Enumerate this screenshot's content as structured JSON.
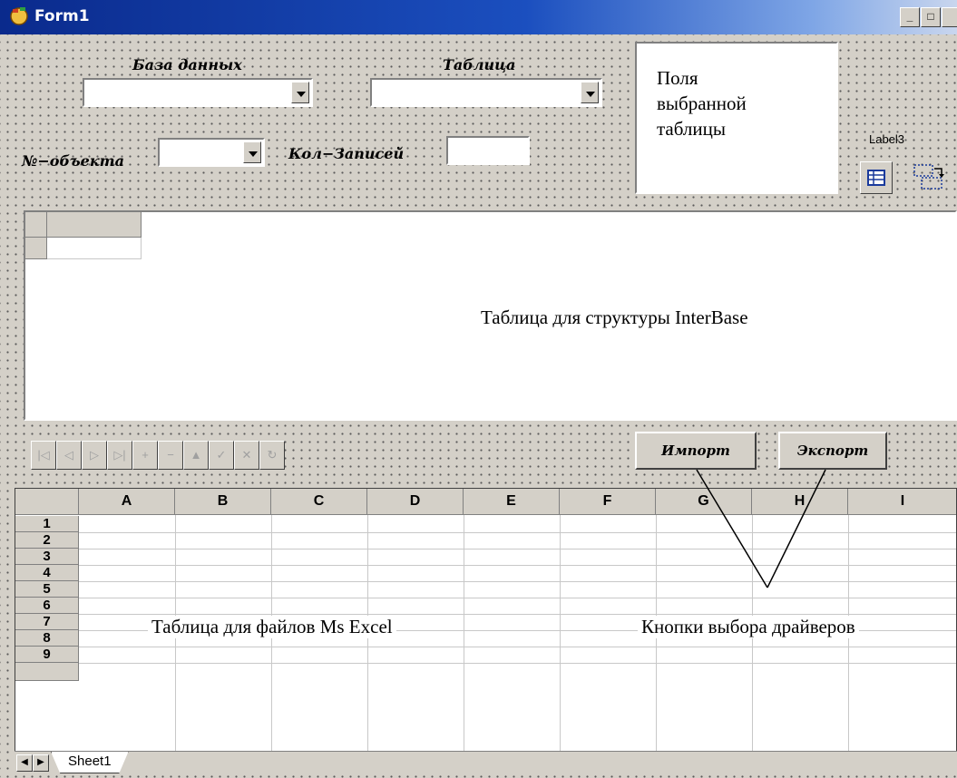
{
  "window": {
    "title": "Form1"
  },
  "labels": {
    "database": "База данных",
    "table": "Таблица",
    "object_no": "№−объекта",
    "record_count": "Кол−Записей",
    "label3": "Label3"
  },
  "fields_panel": {
    "text": "Поля\nвыбранной\nтаблицы"
  },
  "db_grid": {
    "caption": "Таблица для структуры InterBase"
  },
  "navigator": {
    "buttons": [
      "first",
      "prior",
      "next",
      "last",
      "insert",
      "delete",
      "edit",
      "post",
      "cancel",
      "refresh"
    ],
    "glyphs": [
      "|◁",
      "◁",
      "▷",
      "▷|",
      "+",
      "−",
      "▲",
      "✓",
      "✕",
      "↻"
    ]
  },
  "buttons": {
    "import": "Импорт",
    "export": "Экспорт"
  },
  "spreadsheet": {
    "columns": [
      "A",
      "B",
      "C",
      "D",
      "E",
      "F",
      "G",
      "H",
      "I"
    ],
    "rows": [
      "1",
      "2",
      "3",
      "4",
      "5",
      "6",
      "7",
      "8",
      "9"
    ],
    "sheet_tab": "Sheet1",
    "caption": "Таблица для файлов Ms Excel"
  },
  "annotation": {
    "driver_buttons": "Кнопки выбора драйверов"
  }
}
